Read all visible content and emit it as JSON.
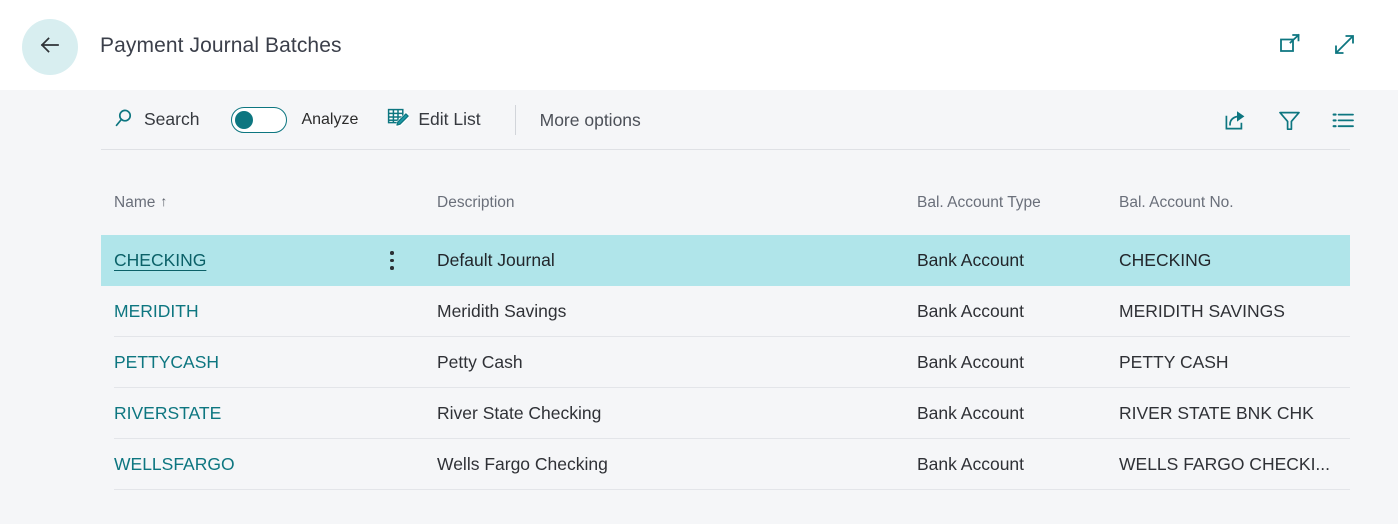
{
  "window": {
    "title": "Payment Journal Batches",
    "back_icon": "arrow-left-icon",
    "actions": [
      {
        "name": "open-in-new-window-icon",
        "label": "Open in new window"
      },
      {
        "name": "expand-icon",
        "label": "Expand"
      }
    ]
  },
  "toolbar": {
    "search_label": "Search",
    "search_icon": "search-icon",
    "analyze_label": "Analyze",
    "analyze_toggle_state": "off",
    "edit_list_label": "Edit List",
    "edit_list_icon": "edit-list-icon",
    "more_options_label": "More options",
    "right_icons": [
      {
        "name": "share-icon",
        "label": "Share"
      },
      {
        "name": "filter-icon",
        "label": "Filter"
      },
      {
        "name": "list-view-icon",
        "label": "Show more"
      }
    ]
  },
  "table": {
    "columns": [
      {
        "key": "name",
        "label": "Name",
        "sort": "ascending",
        "sort_glyph": "↑"
      },
      {
        "key": "description",
        "label": "Description",
        "sort": ""
      },
      {
        "key": "bal_account_type",
        "label": "Bal. Account Type",
        "sort": ""
      },
      {
        "key": "bal_account_no",
        "label": "Bal. Account No.",
        "sort": ""
      }
    ],
    "rows": [
      {
        "name": "CHECKING",
        "description": "Default Journal",
        "bal_account_type": "Bank Account",
        "bal_account_no": "CHECKING",
        "selected": true
      },
      {
        "name": "MERIDITH",
        "description": "Meridith Savings",
        "bal_account_type": "Bank Account",
        "bal_account_no": "MERIDITH SAVINGS",
        "selected": false
      },
      {
        "name": "PETTYCASH",
        "description": "Petty Cash",
        "bal_account_type": "Bank Account",
        "bal_account_no": "PETTY CASH",
        "selected": false
      },
      {
        "name": "RIVERSTATE",
        "description": "River State Checking",
        "bal_account_type": "Bank Account",
        "bal_account_no": "RIVER STATE BNK CHK",
        "selected": false
      },
      {
        "name": "WELLSFARGO",
        "description": "Wells Fargo Checking",
        "bal_account_type": "Bank Account",
        "bal_account_no": "WELLS FARGO CHECKI...",
        "selected": false
      }
    ]
  },
  "colors": {
    "accent": "#0d7680",
    "selection": "#b0e5ea",
    "back_circle": "#d8eef0",
    "page_background": "#f5f6f8",
    "titlebar_background": "#ffffff"
  }
}
